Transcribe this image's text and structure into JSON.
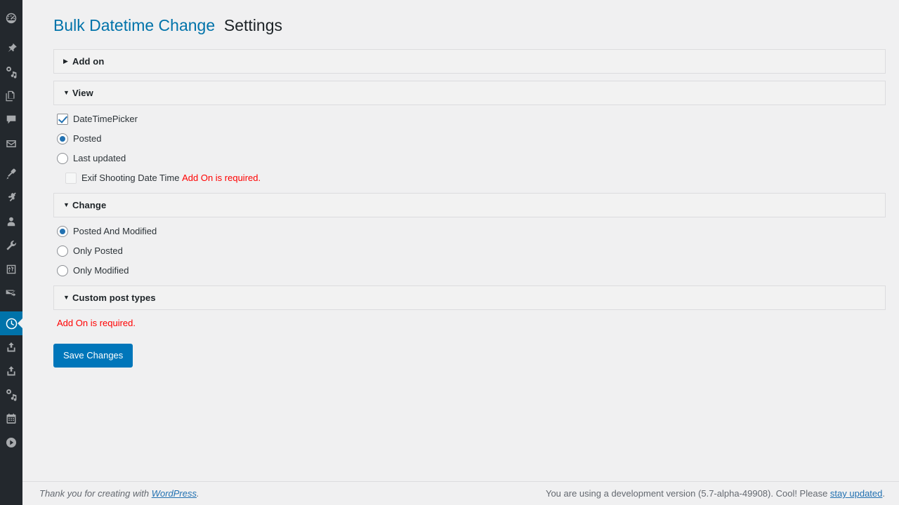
{
  "colors": {
    "sidebar_bg": "#23282d",
    "sidebar_active_bg": "#0073aa",
    "page_bg": "#f0f0f1",
    "accent": "#0073aa",
    "link": "#2271b1",
    "error": "#ff0000",
    "button_bg": "#0076ba"
  },
  "sidebar": {
    "items": [
      {
        "icon": "dashboard-icon",
        "name": "dashboard",
        "active": false
      },
      {
        "icon": "pin-icon",
        "name": "posts",
        "active": false
      },
      {
        "icon": "media-icon",
        "name": "media",
        "active": false
      },
      {
        "icon": "pages-icon",
        "name": "pages",
        "active": false
      },
      {
        "icon": "comment-icon",
        "name": "comments",
        "active": false
      },
      {
        "icon": "mail-icon",
        "name": "mail",
        "active": false
      },
      {
        "icon": "brush-icon",
        "name": "appearance",
        "active": false
      },
      {
        "icon": "plug-icon",
        "name": "plugins",
        "active": false
      },
      {
        "icon": "user-icon",
        "name": "users",
        "active": false
      },
      {
        "icon": "wrench-icon",
        "name": "tools",
        "active": false
      },
      {
        "icon": "sliders-icon",
        "name": "settings",
        "active": false
      },
      {
        "icon": "mail-forward-icon",
        "name": "mail-forward",
        "active": false
      },
      {
        "icon": "clock-icon",
        "name": "bulk-datetime-change",
        "active": true
      },
      {
        "icon": "upload-icon",
        "name": "export-1",
        "active": false
      },
      {
        "icon": "upload-icon",
        "name": "export-2",
        "active": false
      },
      {
        "icon": "media-icon",
        "name": "media-2",
        "active": false
      },
      {
        "icon": "calendar-icon",
        "name": "calendar",
        "active": false
      },
      {
        "icon": "play-icon",
        "name": "player",
        "active": false
      }
    ]
  },
  "header": {
    "plugin_name": "Bulk Datetime Change",
    "page_suffix": "Settings"
  },
  "sections": [
    {
      "key": "addon",
      "label": "Add on",
      "expanded": false,
      "triangle": "▶"
    },
    {
      "key": "view",
      "label": "View",
      "expanded": true,
      "triangle": "▼"
    },
    {
      "key": "change",
      "label": "Change",
      "expanded": true,
      "triangle": "▼"
    },
    {
      "key": "custom_post_types",
      "label": "Custom post types",
      "expanded": true,
      "triangle": "▼"
    }
  ],
  "view_options": [
    {
      "type": "checkbox",
      "label": "DateTimePicker",
      "checked": true,
      "disabled": false,
      "indent": false,
      "note": ""
    },
    {
      "type": "radio",
      "label": "Posted",
      "checked": true,
      "disabled": false,
      "indent": false,
      "note": ""
    },
    {
      "type": "radio",
      "label": "Last updated",
      "checked": false,
      "disabled": false,
      "indent": false,
      "note": ""
    },
    {
      "type": "checkbox",
      "label": "Exif Shooting Date Time",
      "checked": false,
      "disabled": true,
      "indent": true,
      "note": "Add On is required."
    }
  ],
  "change_options": [
    {
      "type": "radio",
      "label": "Posted And Modified",
      "checked": true
    },
    {
      "type": "radio",
      "label": "Only Posted",
      "checked": false
    },
    {
      "type": "radio",
      "label": "Only Modified",
      "checked": false
    }
  ],
  "custom_post_types": {
    "required_notice": "Add On is required."
  },
  "actions": {
    "save_label": "Save Changes"
  },
  "footer": {
    "left_prefix": "Thank you for creating with ",
    "left_link": "WordPress",
    "left_suffix": ".",
    "right_prefix": "You are using a development version (5.7-alpha-49908). Cool! Please ",
    "right_link": "stay updated",
    "right_suffix": "."
  }
}
